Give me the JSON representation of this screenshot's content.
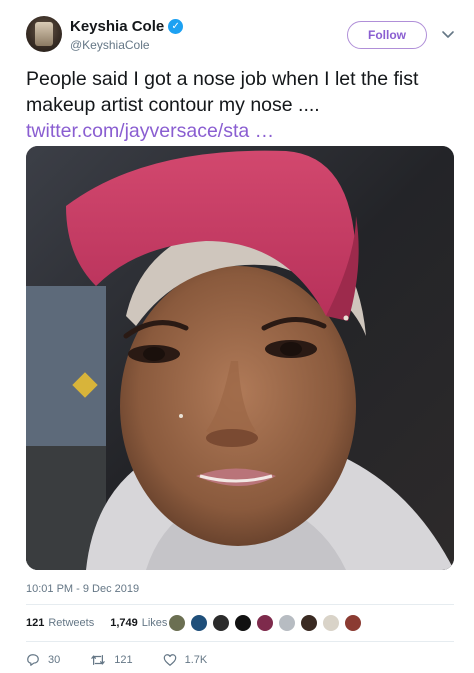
{
  "author": {
    "name": "Keyshia Cole",
    "handle": "@KeyshiaCole",
    "verified": true
  },
  "follow_label": "Follow",
  "tweet": {
    "text": "People said I got a nose job when I let the fist makeup artist contour my nose ....",
    "link": "twitter.com/jayversace/sta …"
  },
  "timestamp": "10:01 PM - 9 Dec 2019",
  "stats": {
    "retweets_count": "121",
    "retweets_label": "Retweets",
    "likes_count": "1,749",
    "likes_label": "Likes"
  },
  "liker_colors": [
    "#6b6f52",
    "#1f4f7a",
    "#2b2b2b",
    "#111111",
    "#7e2a4c",
    "#b7bcc2",
    "#3a2a22",
    "#d9d3c8",
    "#8b3b32"
  ],
  "actions": {
    "replies": "30",
    "retweets": "121",
    "likes": "1.7K"
  },
  "colors": {
    "accent": "#8a5ed1",
    "verified": "#1da1f2",
    "muted": "#657786"
  }
}
